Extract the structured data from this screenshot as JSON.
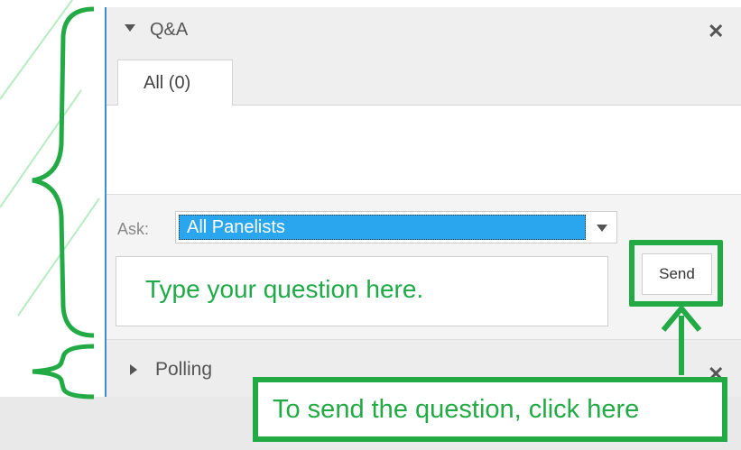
{
  "qa_panel": {
    "title": "Q&A",
    "close_icon": "close-icon",
    "tab_all_label": "All (0)",
    "ask_label": "Ask:",
    "ask_selected": "All Panelists",
    "question_placeholder": "Type your question here.",
    "send_label": "Send"
  },
  "polling_panel": {
    "title": "Polling",
    "close_icon": "close-icon"
  },
  "annotation": {
    "callout_text": "To send the question, click here"
  },
  "colors": {
    "accent_green": "#22aa44",
    "select_blue": "#2aa6ef",
    "divider_blue": "#3b8ed4"
  }
}
